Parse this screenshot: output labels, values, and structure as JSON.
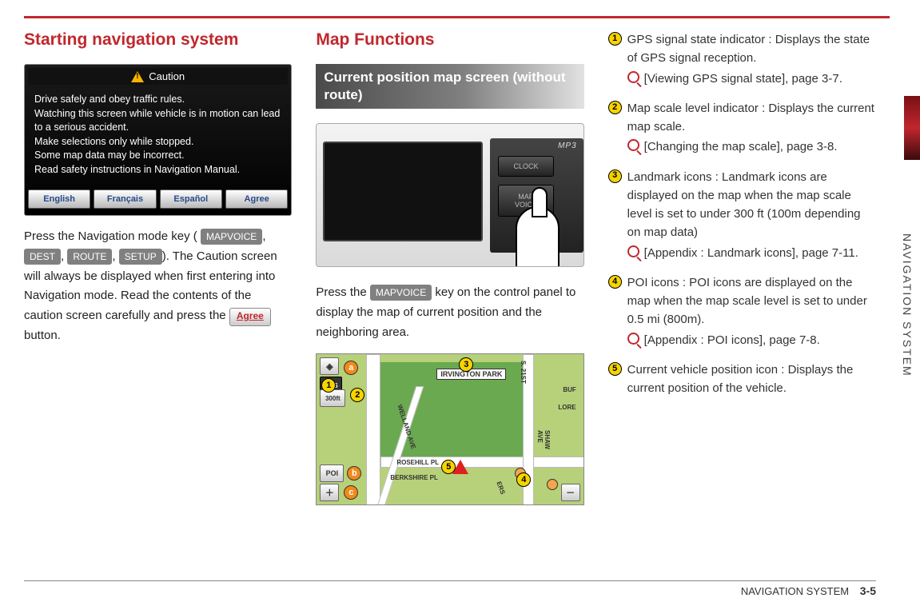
{
  "sideTab": "NAVIGATION SYSTEM",
  "col1": {
    "heading": "Starting navigation system",
    "caution": {
      "title": "Caution",
      "body": "Drive safely and obey traffic rules.\nWatching this screen while vehicle is in motion can lead to a serious accident.\nMake selections only while stopped.\nSome map data may be incorrect.\nRead safety instructions in Navigation Manual.",
      "buttons": [
        "English",
        "Français",
        "Español",
        "Agree"
      ]
    },
    "para_pre": "Press the Navigation mode key (",
    "keys": [
      "MAPVOICE",
      "DEST",
      "ROUTE",
      "SETUP"
    ],
    "para_mid": "). The Caution screen will always be displayed when first entering into Navigation mode. Read the contents of the caution screen carefully and press the ",
    "agree": "Agree",
    "para_post": " button."
  },
  "col2": {
    "heading": "Map Functions",
    "subhead": "Current position map screen (without route)",
    "deviceKeys": {
      "mp3": "MP3",
      "clock": "CLOCK",
      "mapvoice": "MAP\nVOICE"
    },
    "para_pre": "Press the ",
    "key": "MAPVOICE",
    "para_post": " key on the control panel to display the map of current position and the neighboring area.",
    "map": {
      "parkLabel": "IRVINGTON PARK",
      "gps": "GPS",
      "scale": "300ft",
      "poi": "POI",
      "streets": {
        "s21st": "S. 21ST",
        "buf": "BUF",
        "lore": "LORE",
        "shaw": "SHAW AVE",
        "welland": "WELLAND AVE",
        "rosehill": "ROSEHILL PL",
        "berkshire": "BERKSHIRE PL",
        "ers": "ERS"
      },
      "callouts": {
        "a": "a",
        "b": "b",
        "c": "c",
        "n1": "1",
        "n2": "2",
        "n3": "3",
        "n4": "4",
        "n5": "5"
      }
    }
  },
  "col3": {
    "items": [
      {
        "n": "1",
        "text": "GPS signal state indicator : Displays the state of GPS signal reception.",
        "ref": "[Viewing GPS signal state], page 3-7."
      },
      {
        "n": "2",
        "text": "Map scale level indicator : Displays the current map scale.",
        "ref": "[Changing the map scale], page 3-8."
      },
      {
        "n": "3",
        "text": "Landmark icons : Landmark icons are displayed on the map when the map scale level is set to under 300 ft (100m depending on map data)",
        "ref": "[Appendix : Landmark icons], page 7-11."
      },
      {
        "n": "4",
        "text": "POI icons : POI icons are displayed on the map when the map scale level is set to under 0.5 mi (800m).",
        "ref": "[Appendix : POI icons], page 7-8."
      },
      {
        "n": "5",
        "text": "Current vehicle position icon : Displays the current position of the vehicle.",
        "ref": ""
      }
    ]
  },
  "footer": {
    "section": "NAVIGATION SYSTEM",
    "page": "3-5"
  }
}
